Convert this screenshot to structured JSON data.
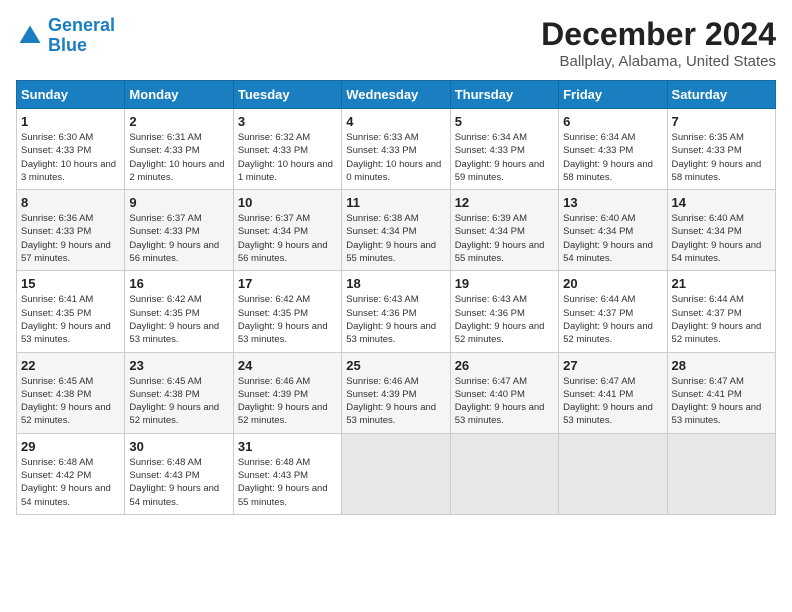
{
  "logo": {
    "line1": "General",
    "line2": "Blue"
  },
  "title": "December 2024",
  "subtitle": "Ballplay, Alabama, United States",
  "days_of_week": [
    "Sunday",
    "Monday",
    "Tuesday",
    "Wednesday",
    "Thursday",
    "Friday",
    "Saturday"
  ],
  "weeks": [
    [
      {
        "day": "1",
        "sunrise": "6:30 AM",
        "sunset": "4:33 PM",
        "daylight": "10 hours and 3 minutes."
      },
      {
        "day": "2",
        "sunrise": "6:31 AM",
        "sunset": "4:33 PM",
        "daylight": "10 hours and 2 minutes."
      },
      {
        "day": "3",
        "sunrise": "6:32 AM",
        "sunset": "4:33 PM",
        "daylight": "10 hours and 1 minute."
      },
      {
        "day": "4",
        "sunrise": "6:33 AM",
        "sunset": "4:33 PM",
        "daylight": "10 hours and 0 minutes."
      },
      {
        "day": "5",
        "sunrise": "6:34 AM",
        "sunset": "4:33 PM",
        "daylight": "9 hours and 59 minutes."
      },
      {
        "day": "6",
        "sunrise": "6:34 AM",
        "sunset": "4:33 PM",
        "daylight": "9 hours and 58 minutes."
      },
      {
        "day": "7",
        "sunrise": "6:35 AM",
        "sunset": "4:33 PM",
        "daylight": "9 hours and 58 minutes."
      }
    ],
    [
      {
        "day": "8",
        "sunrise": "6:36 AM",
        "sunset": "4:33 PM",
        "daylight": "9 hours and 57 minutes."
      },
      {
        "day": "9",
        "sunrise": "6:37 AM",
        "sunset": "4:33 PM",
        "daylight": "9 hours and 56 minutes."
      },
      {
        "day": "10",
        "sunrise": "6:37 AM",
        "sunset": "4:34 PM",
        "daylight": "9 hours and 56 minutes."
      },
      {
        "day": "11",
        "sunrise": "6:38 AM",
        "sunset": "4:34 PM",
        "daylight": "9 hours and 55 minutes."
      },
      {
        "day": "12",
        "sunrise": "6:39 AM",
        "sunset": "4:34 PM",
        "daylight": "9 hours and 55 minutes."
      },
      {
        "day": "13",
        "sunrise": "6:40 AM",
        "sunset": "4:34 PM",
        "daylight": "9 hours and 54 minutes."
      },
      {
        "day": "14",
        "sunrise": "6:40 AM",
        "sunset": "4:34 PM",
        "daylight": "9 hours and 54 minutes."
      }
    ],
    [
      {
        "day": "15",
        "sunrise": "6:41 AM",
        "sunset": "4:35 PM",
        "daylight": "9 hours and 53 minutes."
      },
      {
        "day": "16",
        "sunrise": "6:42 AM",
        "sunset": "4:35 PM",
        "daylight": "9 hours and 53 minutes."
      },
      {
        "day": "17",
        "sunrise": "6:42 AM",
        "sunset": "4:35 PM",
        "daylight": "9 hours and 53 minutes."
      },
      {
        "day": "18",
        "sunrise": "6:43 AM",
        "sunset": "4:36 PM",
        "daylight": "9 hours and 53 minutes."
      },
      {
        "day": "19",
        "sunrise": "6:43 AM",
        "sunset": "4:36 PM",
        "daylight": "9 hours and 52 minutes."
      },
      {
        "day": "20",
        "sunrise": "6:44 AM",
        "sunset": "4:37 PM",
        "daylight": "9 hours and 52 minutes."
      },
      {
        "day": "21",
        "sunrise": "6:44 AM",
        "sunset": "4:37 PM",
        "daylight": "9 hours and 52 minutes."
      }
    ],
    [
      {
        "day": "22",
        "sunrise": "6:45 AM",
        "sunset": "4:38 PM",
        "daylight": "9 hours and 52 minutes."
      },
      {
        "day": "23",
        "sunrise": "6:45 AM",
        "sunset": "4:38 PM",
        "daylight": "9 hours and 52 minutes."
      },
      {
        "day": "24",
        "sunrise": "6:46 AM",
        "sunset": "4:39 PM",
        "daylight": "9 hours and 52 minutes."
      },
      {
        "day": "25",
        "sunrise": "6:46 AM",
        "sunset": "4:39 PM",
        "daylight": "9 hours and 53 minutes."
      },
      {
        "day": "26",
        "sunrise": "6:47 AM",
        "sunset": "4:40 PM",
        "daylight": "9 hours and 53 minutes."
      },
      {
        "day": "27",
        "sunrise": "6:47 AM",
        "sunset": "4:41 PM",
        "daylight": "9 hours and 53 minutes."
      },
      {
        "day": "28",
        "sunrise": "6:47 AM",
        "sunset": "4:41 PM",
        "daylight": "9 hours and 53 minutes."
      }
    ],
    [
      {
        "day": "29",
        "sunrise": "6:48 AM",
        "sunset": "4:42 PM",
        "daylight": "9 hours and 54 minutes."
      },
      {
        "day": "30",
        "sunrise": "6:48 AM",
        "sunset": "4:43 PM",
        "daylight": "9 hours and 54 minutes."
      },
      {
        "day": "31",
        "sunrise": "6:48 AM",
        "sunset": "4:43 PM",
        "daylight": "9 hours and 55 minutes."
      },
      null,
      null,
      null,
      null
    ]
  ],
  "labels": {
    "sunrise": "Sunrise:",
    "sunset": "Sunset:",
    "daylight": "Daylight:"
  }
}
